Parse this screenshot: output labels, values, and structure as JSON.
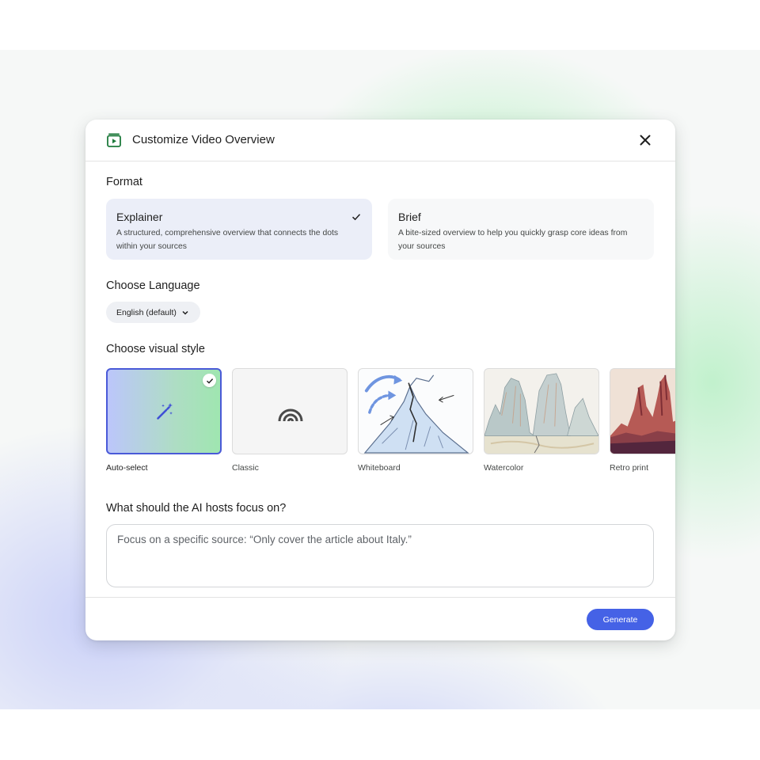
{
  "dialog": {
    "title": "Customize Video Overview",
    "header_icon": "video-overview-icon",
    "close_icon": "close-icon"
  },
  "format": {
    "label": "Format",
    "options": [
      {
        "title": "Explainer",
        "description": "A structured, comprehensive overview that connects the dots within your sources",
        "selected": true
      },
      {
        "title": "Brief",
        "description": "A bite-sized overview to help you quickly grasp core ideas from your sources",
        "selected": false
      }
    ]
  },
  "language": {
    "label": "Choose Language",
    "selected": "English (default)"
  },
  "visual_style": {
    "label": "Choose visual style",
    "options": [
      {
        "label": "Auto-select",
        "icon": "magic-wand-icon",
        "selected": true
      },
      {
        "label": "Classic",
        "icon": "rainbow-arc-icon",
        "selected": false
      },
      {
        "label": "Whiteboard",
        "selected": false
      },
      {
        "label": "Watercolor",
        "selected": false
      },
      {
        "label": "Retro print",
        "selected": false
      }
    ]
  },
  "focus": {
    "label": "What should the AI hosts focus on?",
    "value": "",
    "placeholder": "Focus on a specific source: “Only cover the article about Italy.”"
  },
  "footer": {
    "generate_label": "Generate"
  },
  "colors": {
    "accent": "#4562e6",
    "selected_card": "#ebeef8",
    "selected_tile_border": "#4a5ad8"
  }
}
